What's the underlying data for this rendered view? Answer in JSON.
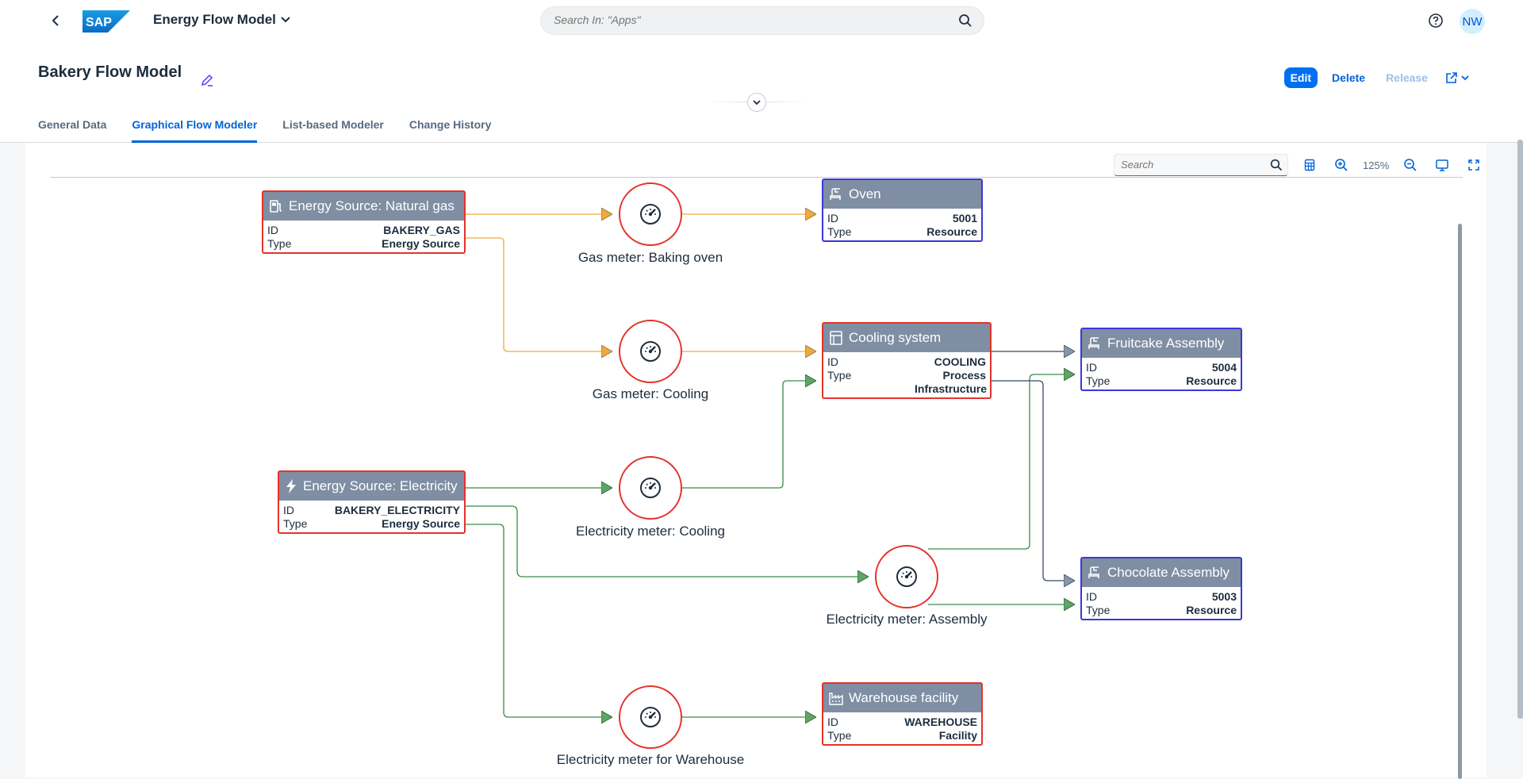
{
  "shellbar": {
    "logo_text": "SAP",
    "app_title": "Energy Flow Model",
    "search_placeholder": "Search In: \"Apps\"",
    "avatar_initials": "NW"
  },
  "header": {
    "title": "Bakery Flow Model",
    "actions": {
      "edit": "Edit",
      "delete": "Delete",
      "release": "Release"
    },
    "tabs": [
      "General Data",
      "Graphical Flow Modeler",
      "List-based Modeler",
      "Change History"
    ],
    "active_tab": "Graphical Flow Modeler"
  },
  "toolbar": {
    "search_placeholder": "Search",
    "zoom": "125%"
  },
  "nodes": {
    "natural_gas": {
      "title": "Energy Source: Natural gas",
      "id_label": "ID",
      "id": "BAKERY_GAS",
      "type_label": "Type",
      "type": "Energy Source"
    },
    "oven": {
      "title": "Oven",
      "id_label": "ID",
      "id": "5001",
      "type_label": "Type",
      "type": "Resource"
    },
    "cooling_system": {
      "title": "Cooling system",
      "id_label": "ID",
      "id": "COOLING",
      "type_label": "Type",
      "type": "Process Infrastructure"
    },
    "fruitcake": {
      "title": "Fruitcake Assembly",
      "id_label": "ID",
      "id": "5004",
      "type_label": "Type",
      "type": "Resource"
    },
    "electricity": {
      "title": "Energy Source: Electricity",
      "id_label": "ID",
      "id": "BAKERY_ELECTRICITY",
      "type_label": "Type",
      "type": "Energy Source"
    },
    "chocolate": {
      "title": "Chocolate Assembly",
      "id_label": "ID",
      "id": "5003",
      "type_label": "Type",
      "type": "Resource"
    },
    "warehouse": {
      "title": "Warehouse facility",
      "id_label": "ID",
      "id": "WAREHOUSE",
      "type_label": "Type",
      "type": "Facility"
    }
  },
  "meters": {
    "gas_baking": "Gas meter: Baking oven",
    "gas_cooling": "Gas meter: Cooling",
    "elec_cooling": "Electricity meter: Cooling",
    "elec_assembly": "Electricity meter: Assembly",
    "elec_warehouse": "Electricity meter for Warehouse"
  },
  "colors": {
    "gas_flow": "#f0a93a",
    "electricity_flow": "#3c8a47",
    "process_flow": "#354a5f",
    "node_border_red": "#e4332a",
    "node_border_blue": "#3b37d9",
    "node_header": "#7f8ea3",
    "accent": "#0064d9"
  }
}
